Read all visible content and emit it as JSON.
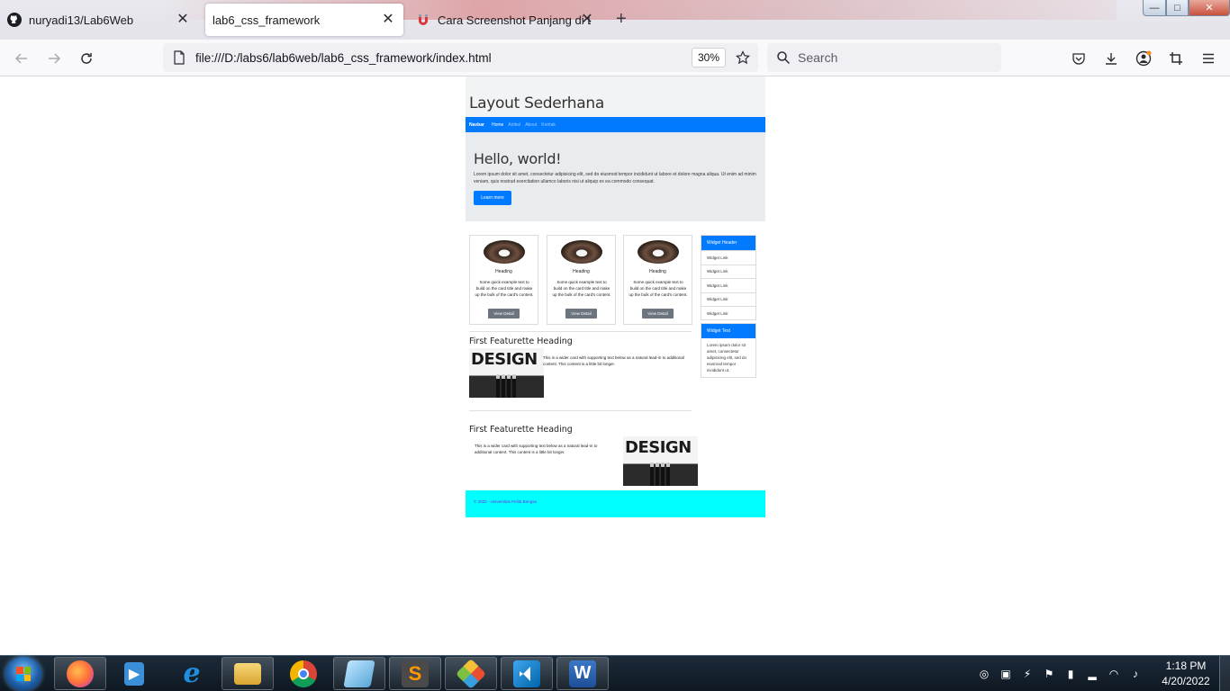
{
  "browser": {
    "tabs": [
      {
        "title": "nuryadi13/Lab6Web",
        "icon": "github-icon",
        "active": false
      },
      {
        "title": "lab6_css_framework",
        "icon": "",
        "active": true
      },
      {
        "title": "Cara Screenshot Panjang di Lap",
        "icon": "magnet-icon",
        "active": false
      }
    ],
    "new_tab": "+",
    "url": "file:///D:/labs6/lab6web/lab6_css_framework/index.html",
    "zoom": "30%",
    "search_placeholder": "Search",
    "window_controls": {
      "minimize": "—",
      "maximize": "□",
      "close": "✕"
    }
  },
  "page": {
    "site_title": "Layout Sederhana",
    "nav": {
      "brand": "Navbar",
      "links": [
        "Home",
        "Artikel",
        "About",
        "Kontak"
      ]
    },
    "jumbotron": {
      "heading": "Hello, world!",
      "text": "Lorem ipsum dolor sit amet, consectetur adipisicing elit, sed do eiusmod tempor incididunt ut labore et dolore magna aliqua. Ut enim ad minim veniam, quis nostrud exercitation ullamco laboris nisi ut aliquip ex ea commodo consequat.",
      "button": "Learn more"
    },
    "cards": [
      {
        "heading": "Heading",
        "text": "Some quick example text to build on the card title and make up the bulk of the card's content.",
        "button": "View Detail"
      },
      {
        "heading": "Heading",
        "text": "Some quick example text to build on the card title and make up the bulk of the card's content.",
        "button": "View Detail"
      },
      {
        "heading": "Heading",
        "text": "Some quick example text to build on the card title and make up the bulk of the card's content.",
        "button": "View Detail"
      }
    ],
    "widget_links": {
      "header": "Widget Header",
      "items": [
        "Widget Link",
        "Widget Link",
        "Widget Link",
        "Widget Link",
        "Widget Link"
      ]
    },
    "widget_text": {
      "header": "Widget Text",
      "text": "Lorem ipsum dolor sit amet, consectetur adipisicing elit, sed do eiusmod tempor incididunt ut."
    },
    "featurettes": [
      {
        "heading": "First Featurette Heading",
        "text": "This is a wider card with supporting text below as a natural lead-in to additional content. This content is a little bit longer.",
        "image_text": "DESIGN"
      },
      {
        "heading": "First Featurette Heading",
        "text": "This is a wider card with supporting text below as a natural lead-in to additional content. This content is a little bit longer.",
        "image_text": "DESIGN"
      }
    ],
    "footer": "© 2022 - Universitas Pelita Bangsa"
  },
  "taskbar": {
    "apps": [
      "firefox-icon",
      "media-player-icon",
      "internet-explorer-icon",
      "file-explorer-icon",
      "chrome-icon",
      "notepad-icon",
      "sublime-text-icon",
      "git-icon",
      "vscode-icon",
      "word-icon"
    ],
    "word_label": "W",
    "time": "1:18 PM",
    "date": "4/20/2022"
  },
  "colors": {
    "primary": "#007bff",
    "footer": "#00ffff",
    "jumbotron": "#e9ecef"
  }
}
